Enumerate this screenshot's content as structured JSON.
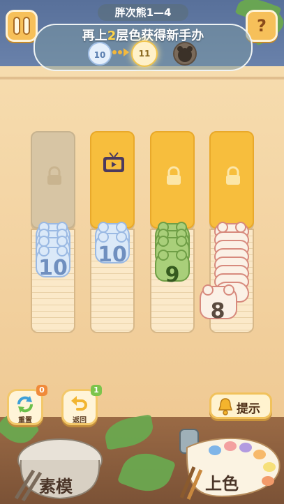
{
  "header": {
    "level_title": "胖次熊1—4",
    "goal_prefix": "再上",
    "goal_number": "2",
    "goal_suffix": "层色获得新手办",
    "progress_tokens": [
      "10",
      "11",
      ""
    ]
  },
  "columns": [
    {
      "state": "locked",
      "stack_number": "10",
      "color": "blue"
    },
    {
      "state": "video-unlock",
      "stack_number": "10",
      "color": "blue"
    },
    {
      "state": "locked",
      "stack_number": "9",
      "color": "green"
    },
    {
      "state": "locked",
      "stack_number": "8",
      "color": "cream"
    }
  ],
  "controls": {
    "reset_label": "重置",
    "reset_badge": "0",
    "undo_label": "返回",
    "undo_badge": "1",
    "hint_label": "提示",
    "sketch_label": "素模",
    "paint_label": "上色"
  },
  "colors": {
    "gold": "#f7be3d",
    "blue_bear": "#dbe9f8",
    "green_bear": "#a9cf7a",
    "cream_bear": "#fbf1e6"
  }
}
